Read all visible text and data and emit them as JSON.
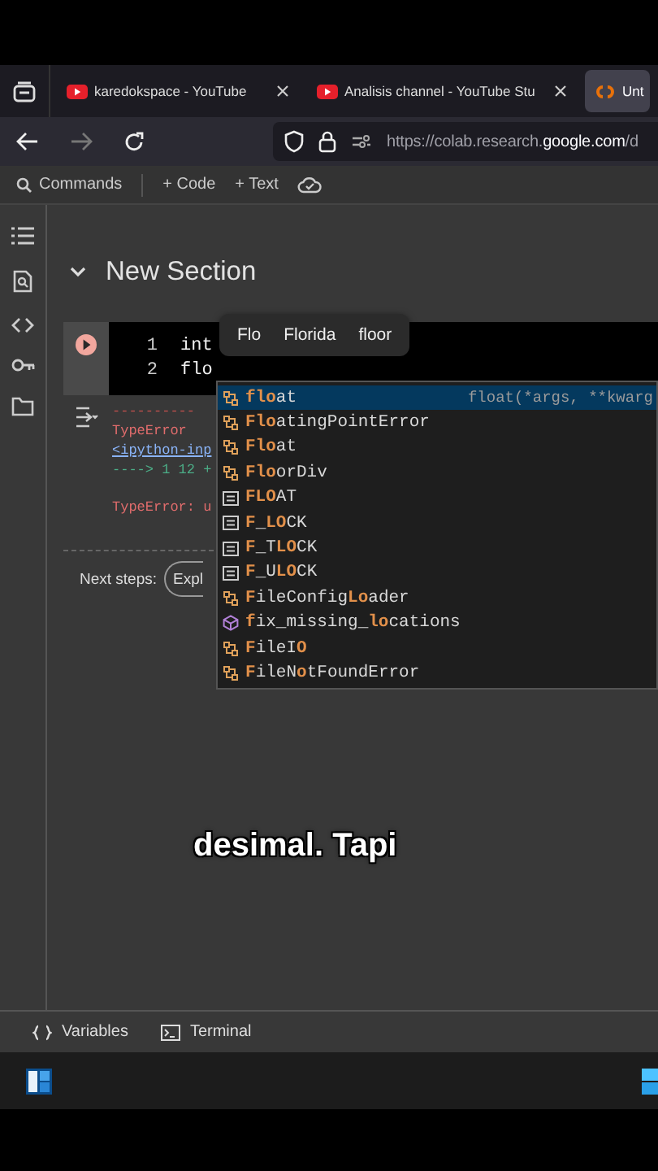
{
  "browser": {
    "tabs": [
      {
        "title": "karedokspace - YouTube",
        "selected": false
      },
      {
        "title": "Analisis channel - YouTube Stu",
        "selected": false
      },
      {
        "title": "Unt",
        "selected": true
      }
    ],
    "url": "https://colab.research.**google.com**/d"
  },
  "toolbar": {
    "items": [
      "Commands",
      "+ Code",
      "+ Text"
    ]
  },
  "section": {
    "title": "New Section",
    "expanded": true
  },
  "cell": {
    "lines": [
      {
        "number": "1",
        "code": "int"
      },
      {
        "number": "2",
        "code": "flo"
      }
    ],
    "output": [
      {
        "kind": "rule",
        "text": "----------"
      },
      {
        "kind": "error",
        "text": "TypeError"
      },
      {
        "kind": "link",
        "text": "<ipython-inp"
      },
      {
        "kind": "arrow",
        "text": "----> 1 12 +"
      },
      {
        "kind": "error",
        "text": "TypeError: u"
      }
    ],
    "next_steps": {
      "label": "Next steps:",
      "button": "Expl"
    }
  },
  "suggestions": [
    "Flo",
    "Florida",
    "floor"
  ],
  "autocomplete": {
    "items": [
      {
        "kind": "class",
        "selected": true,
        "parts": [
          {
            "text": "flo",
            "match": true
          },
          {
            "text": "at",
            "match": false
          }
        ],
        "detail": "float(*args, **kwarg"
      },
      {
        "kind": "class",
        "selected": false,
        "parts": [
          {
            "text": "Flo",
            "match": true
          },
          {
            "text": "atingPointError",
            "match": false
          }
        ]
      },
      {
        "kind": "class",
        "selected": false,
        "parts": [
          {
            "text": "Flo",
            "match": true
          },
          {
            "text": "at",
            "match": false
          }
        ]
      },
      {
        "kind": "class",
        "selected": false,
        "parts": [
          {
            "text": "Flo",
            "match": true
          },
          {
            "text": "orDiv",
            "match": false
          }
        ]
      },
      {
        "kind": "constant",
        "selected": false,
        "parts": [
          {
            "text": "FLO",
            "match": true
          },
          {
            "text": "AT",
            "match": false
          }
        ]
      },
      {
        "kind": "constant",
        "selected": false,
        "parts": [
          {
            "text": "F",
            "match": true
          },
          {
            "text": "_",
            "match": false
          },
          {
            "text": "LO",
            "match": true
          },
          {
            "text": "CK",
            "match": false
          }
        ]
      },
      {
        "kind": "constant",
        "selected": false,
        "parts": [
          {
            "text": "F",
            "match": true
          },
          {
            "text": "_T",
            "match": false
          },
          {
            "text": "LO",
            "match": true
          },
          {
            "text": "CK",
            "match": false
          }
        ]
      },
      {
        "kind": "constant",
        "selected": false,
        "parts": [
          {
            "text": "F",
            "match": true
          },
          {
            "text": "_U",
            "match": false
          },
          {
            "text": "LO",
            "match": true
          },
          {
            "text": "CK",
            "match": false
          }
        ]
      },
      {
        "kind": "class",
        "selected": false,
        "parts": [
          {
            "text": "F",
            "match": true
          },
          {
            "text": "ileConfig",
            "match": false
          },
          {
            "text": "Lo",
            "match": true
          },
          {
            "text": "ader",
            "match": false
          }
        ]
      },
      {
        "kind": "function",
        "selected": false,
        "parts": [
          {
            "text": "f",
            "match": true
          },
          {
            "text": "ix_missing_",
            "match": false
          },
          {
            "text": "lo",
            "match": true
          },
          {
            "text": "cations",
            "match": false
          }
        ]
      },
      {
        "kind": "class",
        "selected": false,
        "parts": [
          {
            "text": "F",
            "match": true
          },
          {
            "text": "ileI",
            "match": false
          },
          {
            "text": "O",
            "match": true
          }
        ]
      },
      {
        "kind": "class",
        "selected": false,
        "parts": [
          {
            "text": "F",
            "match": true
          },
          {
            "text": "ileN",
            "match": false
          },
          {
            "text": "o",
            "match": true
          },
          {
            "text": "tFoundError",
            "match": false
          }
        ]
      }
    ]
  },
  "caption": "desimal. Tapi",
  "bottom_bar": {
    "items": [
      "Variables",
      "Terminal"
    ]
  }
}
